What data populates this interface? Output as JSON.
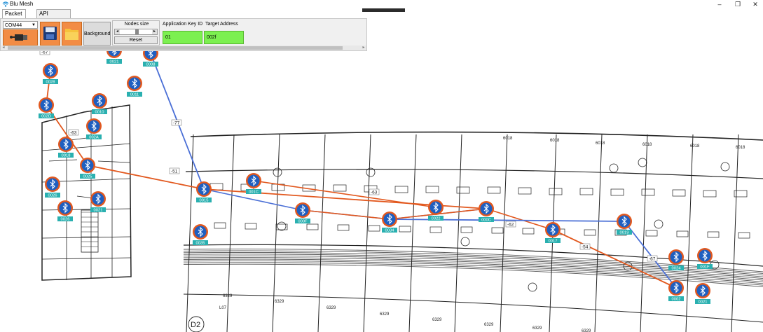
{
  "window": {
    "title": "Blu Mesh",
    "controls": {
      "minimize": "–",
      "maximize": "❐",
      "close": "✕"
    }
  },
  "tabs": [
    {
      "label": "Packet Tracing",
      "active": true
    },
    {
      "label": "API Commands",
      "active": false
    }
  ],
  "toolbar": {
    "com_port": "COM44",
    "background_label": "Background",
    "nodes_size_label": "Nodes size",
    "nodes_size_value": 0.45,
    "reset_label": "Reset",
    "app_key_label": "Application Key ID",
    "app_key_value": "01",
    "target_label": "Target Address",
    "target_value": "002f",
    "icons": [
      "connect-icon",
      "save-icon",
      "folder-icon"
    ]
  },
  "colors": {
    "accent_orange": "#f28c45",
    "field_green": "#7cf050",
    "node_blue": "#1f5fc0",
    "node_ring": "#e2581e",
    "label_teal": "#2ab0b0",
    "link_orange": "#e2581e",
    "link_blue": "#4a6fd6"
  },
  "nodes": [
    "0028",
    "0008",
    "0029",
    "002D",
    "0011",
    "0010",
    "002A",
    "0018",
    "0016",
    "0025",
    "0019",
    "0021",
    "0026",
    "001A",
    "0015",
    "001C",
    "0035",
    "000F",
    "0034",
    "0022",
    "000C",
    "0017",
    "0019",
    "0024",
    "001F",
    "0002",
    "0021"
  ],
  "link_labels": [
    "-67",
    "-63",
    "-51",
    "-77",
    "-63",
    "-62",
    "-54",
    "-67"
  ],
  "floorplan_labels": [
    "6018",
    "6018",
    "6018",
    "6018",
    "6018",
    "6018",
    "6329",
    "6329",
    "6329",
    "6329",
    "6329",
    "6329",
    "6329",
    "6329",
    "L07",
    "D2"
  ]
}
